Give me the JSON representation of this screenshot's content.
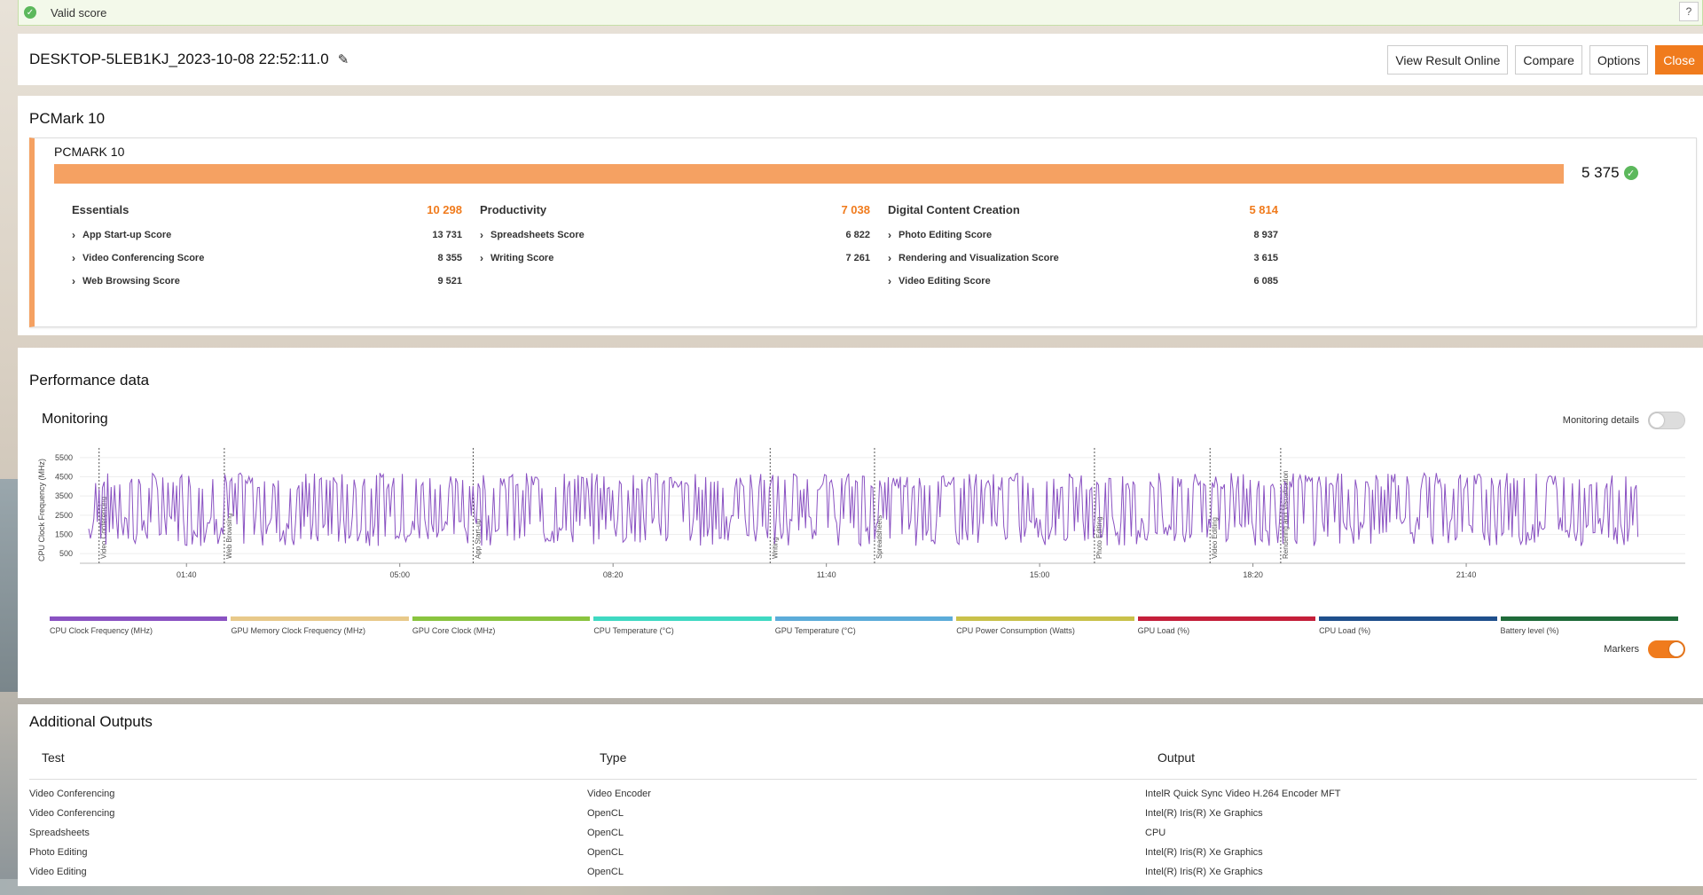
{
  "valid": {
    "label": "Valid score",
    "help": "?"
  },
  "header": {
    "title": "DESKTOP-5LEB1KJ_2023-10-08 22:52:11.0",
    "buttons": {
      "view": "View Result Online",
      "compare": "Compare",
      "options": "Options",
      "close": "Close"
    }
  },
  "score": {
    "section_title": "PCMark 10",
    "card_label": "PCMARK 10",
    "total": "5 375",
    "groups": [
      {
        "name": "Essentials",
        "value": "10 298",
        "items": [
          {
            "label": "App Start-up Score",
            "value": "13 731"
          },
          {
            "label": "Video Conferencing Score",
            "value": "8 355"
          },
          {
            "label": "Web Browsing Score",
            "value": "9 521"
          }
        ]
      },
      {
        "name": "Productivity",
        "value": "7 038",
        "items": [
          {
            "label": "Spreadsheets Score",
            "value": "6 822"
          },
          {
            "label": "Writing Score",
            "value": "7 261"
          }
        ]
      },
      {
        "name": "Digital Content Creation",
        "value": "5 814",
        "items": [
          {
            "label": "Photo Editing Score",
            "value": "8 937"
          },
          {
            "label": "Rendering and Visualization Score",
            "value": "3 615"
          },
          {
            "label": "Video Editing Score",
            "value": "6 085"
          }
        ]
      }
    ],
    "accent": "#f5a162"
  },
  "perf": {
    "section_title": "Performance data",
    "monitoring_title": "Monitoring",
    "monitoring_details_label": "Monitoring details",
    "markers_label": "Markers",
    "legend": [
      {
        "label": "CPU Clock Frequency (MHz)",
        "color": "#8a52c2"
      },
      {
        "label": "GPU Memory Clock Frequency (MHz)",
        "color": "#e8c98a"
      },
      {
        "label": "GPU Core Clock (MHz)",
        "color": "#8ac43f"
      },
      {
        "label": "CPU Temperature (°C)",
        "color": "#3fd9c2"
      },
      {
        "label": "GPU Temperature (°C)",
        "color": "#5cacd9"
      },
      {
        "label": "CPU Power Consumption (Watts)",
        "color": "#c9c14a"
      },
      {
        "label": "GPU Load (%)",
        "color": "#c41f3a"
      },
      {
        "label": "CPU Load (%)",
        "color": "#1f4f8c"
      },
      {
        "label": "Battery level (%)",
        "color": "#1f6b3a"
      }
    ]
  },
  "chart_data": {
    "type": "line",
    "ylabel": "CPU Clock Frequency (MHz)",
    "yticks": [
      "5500",
      "4500",
      "3500",
      "2500",
      "1500",
      "500"
    ],
    "ylim": [
      0,
      6000
    ],
    "xticks": [
      "01:40",
      "05:00",
      "08:20",
      "11:40",
      "15:00",
      "18:20",
      "21:40"
    ],
    "markers": [
      "Video Conferencing",
      "Web Browsing",
      "App Start-up",
      "Writing",
      "Spreadsheets",
      "Photo Editing",
      "Video Editing",
      "Rendering and Visualization"
    ],
    "series": [
      {
        "values": [
          4500,
          1500,
          4200,
          1200,
          4500,
          1000,
          4400,
          1300,
          4500,
          1100
        ]
      }
    ],
    "line_color": "#8a52c2"
  },
  "outputs": {
    "title": "Additional Outputs",
    "headers": [
      "Test",
      "Type",
      "Output"
    ],
    "rows": [
      [
        "Video Conferencing",
        "Video Encoder",
        "IntelR Quick Sync Video H.264 Encoder MFT"
      ],
      [
        "Video Conferencing",
        "OpenCL",
        "Intel(R) Iris(R) Xe Graphics"
      ],
      [
        "Spreadsheets",
        "OpenCL",
        "CPU"
      ],
      [
        "Photo Editing",
        "OpenCL",
        "Intel(R) Iris(R) Xe Graphics"
      ],
      [
        "Video Editing",
        "OpenCL",
        "Intel(R) Iris(R) Xe Graphics"
      ]
    ]
  }
}
